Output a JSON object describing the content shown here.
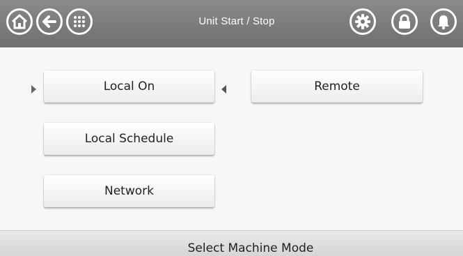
{
  "header": {
    "title": "Unit Start / Stop",
    "left_icons": [
      "home-icon",
      "back-arrow-icon",
      "menu-grid-icon"
    ],
    "right_icons": [
      "gear-icon",
      "lock-icon",
      "bell-icon"
    ]
  },
  "mode_buttons": {
    "local_on": "Local On",
    "remote": "Remote",
    "local_schedule": "Local Schedule",
    "network": "Network",
    "selected": "Local On"
  },
  "status": {
    "text": "Select Machine Mode"
  },
  "colors": {
    "header_bg": "#7d7d7d",
    "header_fg": "#ffffff",
    "panel_bg": "#f7f7f7",
    "button_bg": "#f5f5f5",
    "status_bg": "#e0e0e0"
  }
}
